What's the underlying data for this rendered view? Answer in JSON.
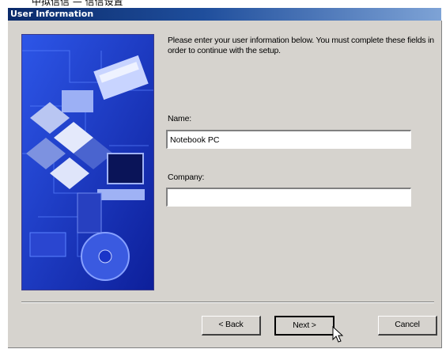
{
  "top_strip_text": "中拟信信 — 信信设置",
  "window": {
    "title": "User Information"
  },
  "intro_text": "Please enter your user information below.  You must complete these fields in order to continue with the setup.",
  "fields": {
    "name": {
      "label": "Name:",
      "value": "Notebook PC"
    },
    "company": {
      "label": "Company:",
      "value": ""
    }
  },
  "buttons": {
    "back": "< Back",
    "next": "Next >",
    "cancel": "Cancel"
  },
  "colors": {
    "dialog": "#d6d3ce",
    "title_start": "#0a2a6a",
    "title_end": "#7ea3d6",
    "art_blue": "#1a35c8"
  }
}
